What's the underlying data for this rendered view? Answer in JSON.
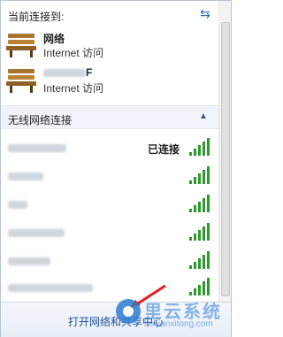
{
  "current_section": {
    "title": "当前连接到:"
  },
  "connections": [
    {
      "name": "网络",
      "access": "Internet 访问",
      "name_hidden": false
    },
    {
      "name": "F",
      "access": "Internet 访问",
      "name_hidden": true
    }
  ],
  "wireless_section": {
    "title": "无线网络连接"
  },
  "wireless_networks": [
    {
      "status": "已连接",
      "signal_bars": 5
    },
    {
      "status": "",
      "signal_bars": 5
    },
    {
      "status": "",
      "signal_bars": 5
    },
    {
      "status": "",
      "signal_bars": 5
    },
    {
      "status": "",
      "signal_bars": 5
    },
    {
      "status": "",
      "signal_bars": 5
    }
  ],
  "footer": {
    "link": "打开网络和共享中心"
  },
  "watermark": {
    "brand": "里云系统",
    "url": "heiyunxitong.com"
  },
  "colors": {
    "signal": "#2e9a2e",
    "link": "#1e4f9a",
    "header_bg": "#f0f4fa",
    "accent": "#2a6ebd"
  },
  "icons": {
    "refresh": "refresh-arrows-icon",
    "bench": "park-bench-network-icon",
    "signal": "wifi-signal-bars-icon",
    "chevron": "chevron-up-icon"
  }
}
